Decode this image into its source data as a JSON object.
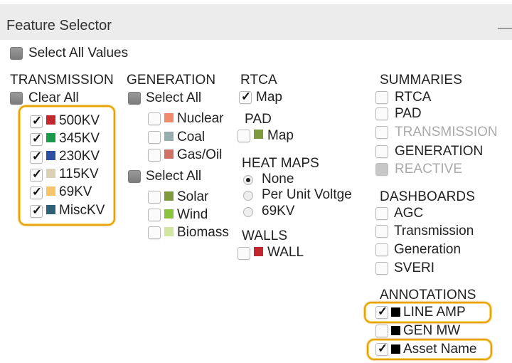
{
  "header": {
    "title": "Feature Selector"
  },
  "select_all_values": "Select All Values",
  "transmission": {
    "heading": "TRANSMISSION",
    "clear_all": "Clear All",
    "items": [
      {
        "label": "500KV",
        "color": "#c1272d",
        "checked": true
      },
      {
        "label": "345KV",
        "color": "#1a9a4a",
        "checked": true
      },
      {
        "label": "230KV",
        "color": "#2e4fa2",
        "checked": true
      },
      {
        "label": "115KV",
        "color": "#d9d2b6",
        "checked": true
      },
      {
        "label": "69KV",
        "color": "#f6c46a",
        "checked": true
      },
      {
        "label": "MiscKV",
        "color": "#2e6078",
        "checked": true
      }
    ]
  },
  "generation": {
    "heading": "GENERATION",
    "select_all_1": "Select All",
    "group1": [
      {
        "label": "Nuclear",
        "color": "#f08a6a",
        "checked": false
      },
      {
        "label": "Coal",
        "color": "#98aeae",
        "checked": false
      },
      {
        "label": "Gas/Oil",
        "color": "#cf7265",
        "checked": false
      }
    ],
    "select_all_2": "Select All",
    "group2": [
      {
        "label": "Solar",
        "color": "#7e9a3c",
        "checked": false
      },
      {
        "label": "Wind",
        "color": "#8ac43f",
        "checked": false
      },
      {
        "label": "Biomass",
        "color": "#d3e6a1",
        "checked": false
      }
    ]
  },
  "rtca": {
    "heading": "RTCA",
    "map_label": "Map",
    "checked": true
  },
  "pad": {
    "heading": "PAD",
    "map_label": "Map",
    "color": "#7e9a3c",
    "checked": false
  },
  "heat_maps": {
    "heading": "HEAT MAPS",
    "options": [
      "None",
      "Per Unit Voltge",
      "69KV"
    ],
    "selected": "None"
  },
  "walls": {
    "heading": "WALLS",
    "item_label": "WALL",
    "color": "#c1272d",
    "checked": false
  },
  "summaries": {
    "heading": "SUMMARIES",
    "items": [
      {
        "label": "RTCA",
        "disabled": false
      },
      {
        "label": "PAD",
        "disabled": false
      },
      {
        "label": "TRANSMISSION",
        "disabled": true
      },
      {
        "label": "GENERATION",
        "disabled": false
      },
      {
        "label": "REACTIVE",
        "disabled": true
      }
    ]
  },
  "dashboards": {
    "heading": "DASHBOARDS",
    "items": [
      "AGC",
      "Transmission",
      "Generation",
      "SVERI"
    ]
  },
  "annotations": {
    "heading": "ANNOTATIONS",
    "items": [
      {
        "label": "LINE AMP",
        "checked": true,
        "color": "#000000"
      },
      {
        "label": "GEN MW",
        "checked": false,
        "color": "#000000"
      },
      {
        "label": "Asset Name",
        "checked": true,
        "color": "#000000"
      }
    ]
  },
  "colors": {
    "highlight": "#e8a200",
    "header_bg": "#ececec"
  },
  "check_glyph": "✓"
}
